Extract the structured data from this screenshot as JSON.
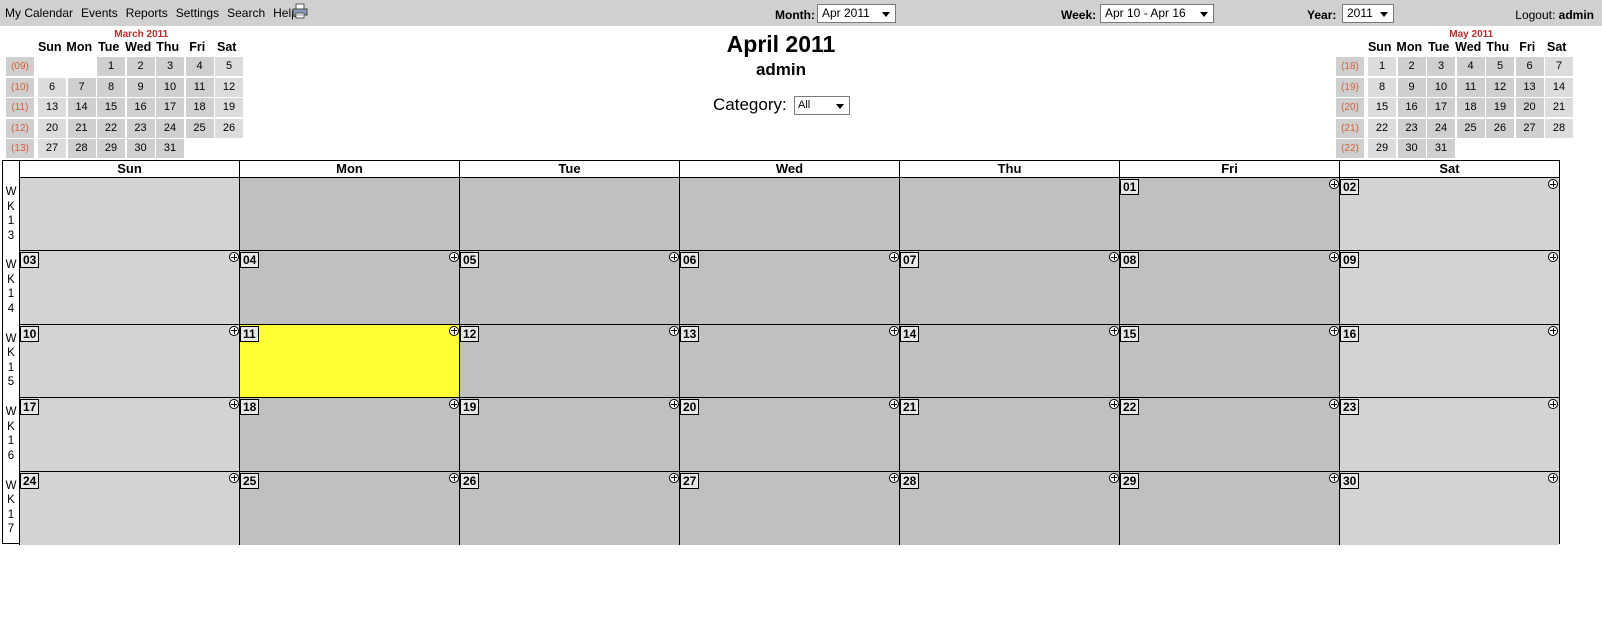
{
  "menu": [
    "My Calendar",
    "Events",
    "Reports",
    "Settings",
    "Search",
    "Help"
  ],
  "print_icon": "printer-icon",
  "month_label": "Month:",
  "month_value": "Apr 2011",
  "week_label": "Week:",
  "week_value": "Apr 10 - Apr 16",
  "year_label": "Year:",
  "year_value": "2011",
  "logout_label": "Logout:",
  "logout_user": "admin",
  "title": "April 2011",
  "subtitle": "admin",
  "category_label": "Category:",
  "category_value": "All",
  "colors": {
    "topbar": "#d0d0d0",
    "cell_dark": "#c0c0c0",
    "cell_light": "#d3d3d3",
    "today": "#ffff33",
    "week_no": "#d2603a",
    "mini_title": "#b03030"
  },
  "mini_prev": {
    "title": "March 2011",
    "days": [
      "Sun",
      "Mon",
      "Tue",
      "Wed",
      "Thu",
      "Fri",
      "Sat"
    ],
    "weeks": [
      {
        "wk": "(09)",
        "days": [
          "",
          "",
          "1",
          "2",
          "3",
          "4",
          "5"
        ]
      },
      {
        "wk": "(10)",
        "days": [
          "6",
          "7",
          "8",
          "9",
          "10",
          "11",
          "12"
        ]
      },
      {
        "wk": "(11)",
        "days": [
          "13",
          "14",
          "15",
          "16",
          "17",
          "18",
          "19"
        ]
      },
      {
        "wk": "(12)",
        "days": [
          "20",
          "21",
          "22",
          "23",
          "24",
          "25",
          "26"
        ]
      },
      {
        "wk": "(13)",
        "days": [
          "27",
          "28",
          "29",
          "30",
          "31",
          "",
          ""
        ]
      }
    ]
  },
  "mini_next": {
    "title": "May 2011",
    "days": [
      "Sun",
      "Mon",
      "Tue",
      "Wed",
      "Thu",
      "Fri",
      "Sat"
    ],
    "weeks": [
      {
        "wk": "(18)",
        "days": [
          "1",
          "2",
          "3",
          "4",
          "5",
          "6",
          "7"
        ]
      },
      {
        "wk": "(19)",
        "days": [
          "8",
          "9",
          "10",
          "11",
          "12",
          "13",
          "14"
        ]
      },
      {
        "wk": "(20)",
        "days": [
          "15",
          "16",
          "17",
          "18",
          "19",
          "20",
          "21"
        ]
      },
      {
        "wk": "(21)",
        "days": [
          "22",
          "23",
          "24",
          "25",
          "26",
          "27",
          "28"
        ]
      },
      {
        "wk": "(22)",
        "days": [
          "29",
          "30",
          "31",
          "",
          "",
          "",
          ""
        ]
      }
    ]
  },
  "grid": {
    "days": [
      "Sun",
      "Mon",
      "Tue",
      "Wed",
      "Thu",
      "Fri",
      "Sat"
    ],
    "today": "11",
    "weeks": [
      {
        "label": "WK13",
        "days": [
          "",
          "",
          "",
          "",
          "",
          "01",
          "02"
        ]
      },
      {
        "label": "WK14",
        "days": [
          "03",
          "04",
          "05",
          "06",
          "07",
          "08",
          "09"
        ]
      },
      {
        "label": "WK15",
        "days": [
          "10",
          "11",
          "12",
          "13",
          "14",
          "15",
          "16"
        ]
      },
      {
        "label": "WK16",
        "days": [
          "17",
          "18",
          "19",
          "20",
          "21",
          "22",
          "23"
        ]
      },
      {
        "label": "WK17",
        "days": [
          "24",
          "25",
          "26",
          "27",
          "28",
          "29",
          "30"
        ]
      }
    ]
  }
}
